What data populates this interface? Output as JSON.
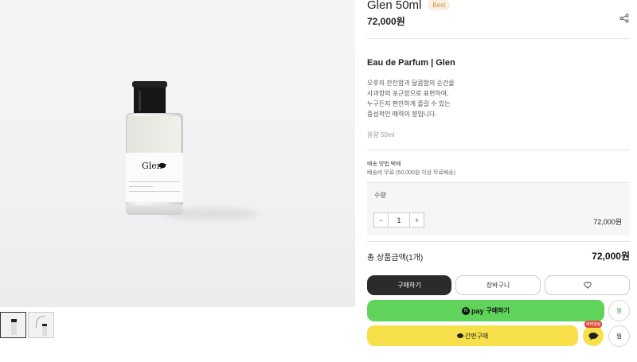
{
  "product": {
    "title": "Glen 50ml",
    "badge": "Best",
    "price": "72,000원",
    "subtitle": "Eau de Parfum | Glen",
    "description": [
      "오후의 잔잔함과 달콤함의 순간을",
      "사과향의 포근함으로 표현하여,",
      "누구든지 편안하게 즐길 수 있는",
      "중성적인 매력의 향입니다."
    ],
    "volume": "용량 50ml",
    "bottle_label": "Glen"
  },
  "shipping": {
    "method": "배송 방법   택배",
    "fee": "배송비   무료 (50,000원 이상 무료배송)"
  },
  "quantity": {
    "label": "수량",
    "minus": "−",
    "value": "1",
    "plus": "+",
    "price": "72,000원"
  },
  "total": {
    "label": "총 상품금액(1개)",
    "price": "72,000원"
  },
  "buttons": {
    "buy": "구매하기",
    "cart": "장바구니",
    "wishlist_icon": "heart-icon",
    "naver_n": "N",
    "naver_pay": "pay",
    "naver_buy": "구매하기",
    "jjim": "찜",
    "kakao_buy": "간편구매",
    "kakao_badge": "혜택알림",
    "kakao_chat_icon": "chat-bubble-icon",
    "jjim2": "찜"
  },
  "icons": {
    "share": "share-icon"
  },
  "colors": {
    "naver_green": "#5fd35a",
    "kakao_yellow": "#f7e04a",
    "buy_dark": "#2b2b2b",
    "badge_bg": "#fbeede"
  }
}
